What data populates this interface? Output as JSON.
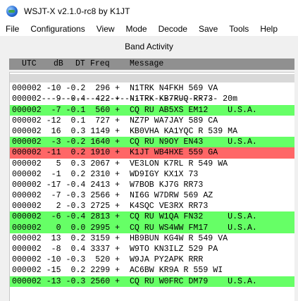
{
  "window": {
    "title": "WSJT-X   v2.1.0-rc8   by K1JT"
  },
  "menu": [
    "File",
    "Configurations",
    "View",
    "Mode",
    "Decode",
    "Save",
    "Tools",
    "Help"
  ],
  "band_activity": {
    "title": "Band Activity",
    "columns": {
      "utc": "UTC",
      "db": "dB",
      "dt": "DT",
      "freq": "Freq",
      "message": "Message"
    },
    "separator": "------------------------------------ 20m",
    "rows": [
      {
        "text": "000002 -10 -0.2  296 +  N1TRK N4FKH 569 VA",
        "type": "normal"
      },
      {
        "text": "000002  -9 -0.4  422 +  N1TRK KB7RUQ RR73",
        "type": "normal"
      },
      {
        "text": "000002  -7 -0.1  560 +  CQ RU AB5XS EM12    U.S.A.",
        "type": "cq"
      },
      {
        "text": "000002 -12  0.1  727 +  NZ7P WA7JAY 589 CA",
        "type": "normal"
      },
      {
        "text": "000002  16  0.3 1149 +  KB0VHA KA1YQC R 539 MA",
        "type": "normal"
      },
      {
        "text": "000002  -3 -0.2 1640 +  CQ RU N9OY EN43     U.S.A.",
        "type": "cq"
      },
      {
        "text": "000002 -11  0.2 1910 +  K1JT WB4HXE 559 GA",
        "type": "mine"
      },
      {
        "text": "000002   5  0.3 2067 +  VE3LON K7RL R 549 WA",
        "type": "normal"
      },
      {
        "text": "000002  -1  0.2 2310 +  WD9IGY KX1X 73",
        "type": "normal"
      },
      {
        "text": "000002 -17 -0.4 2413 +  W7BOB KJ7G RR73",
        "type": "normal"
      },
      {
        "text": "000002  -7 -0.3 2566 +  NI6G W7DRW 569 AZ",
        "type": "normal"
      },
      {
        "text": "000002   2 -0.3 2725 +  K4SQC VE3RX RR73",
        "type": "normal"
      },
      {
        "text": "000002  -6 -0.4 2813 +  CQ RU W1QA FN32     U.S.A.",
        "type": "cq"
      },
      {
        "text": "000002   0  0.0 2995 +  CQ RU WS4WW FM17    U.S.A.",
        "type": "cq"
      },
      {
        "text": "000002  13  0.2 3159 +  HB9BUN KG4W R 549 VA",
        "type": "normal"
      },
      {
        "text": "000002  -8  0.4 3337 +  W9TO KN3ILZ 529 PA",
        "type": "normal"
      },
      {
        "text": "000002 -10 -0.3  520 +  W9JA PY2APK RRR",
        "type": "normal"
      },
      {
        "text": "000002 -15  0.2 2299 +  AC6BW KR9A R 559 WI",
        "type": "normal"
      },
      {
        "text": "000002 -13 -0.3 2560 +  CQ RU W0FRC DM79    U.S.A.",
        "type": "cq"
      }
    ]
  },
  "colors": {
    "cq_highlight": "#66ff66",
    "my_call_highlight": "#ff6666",
    "header_bg": "#909090"
  }
}
